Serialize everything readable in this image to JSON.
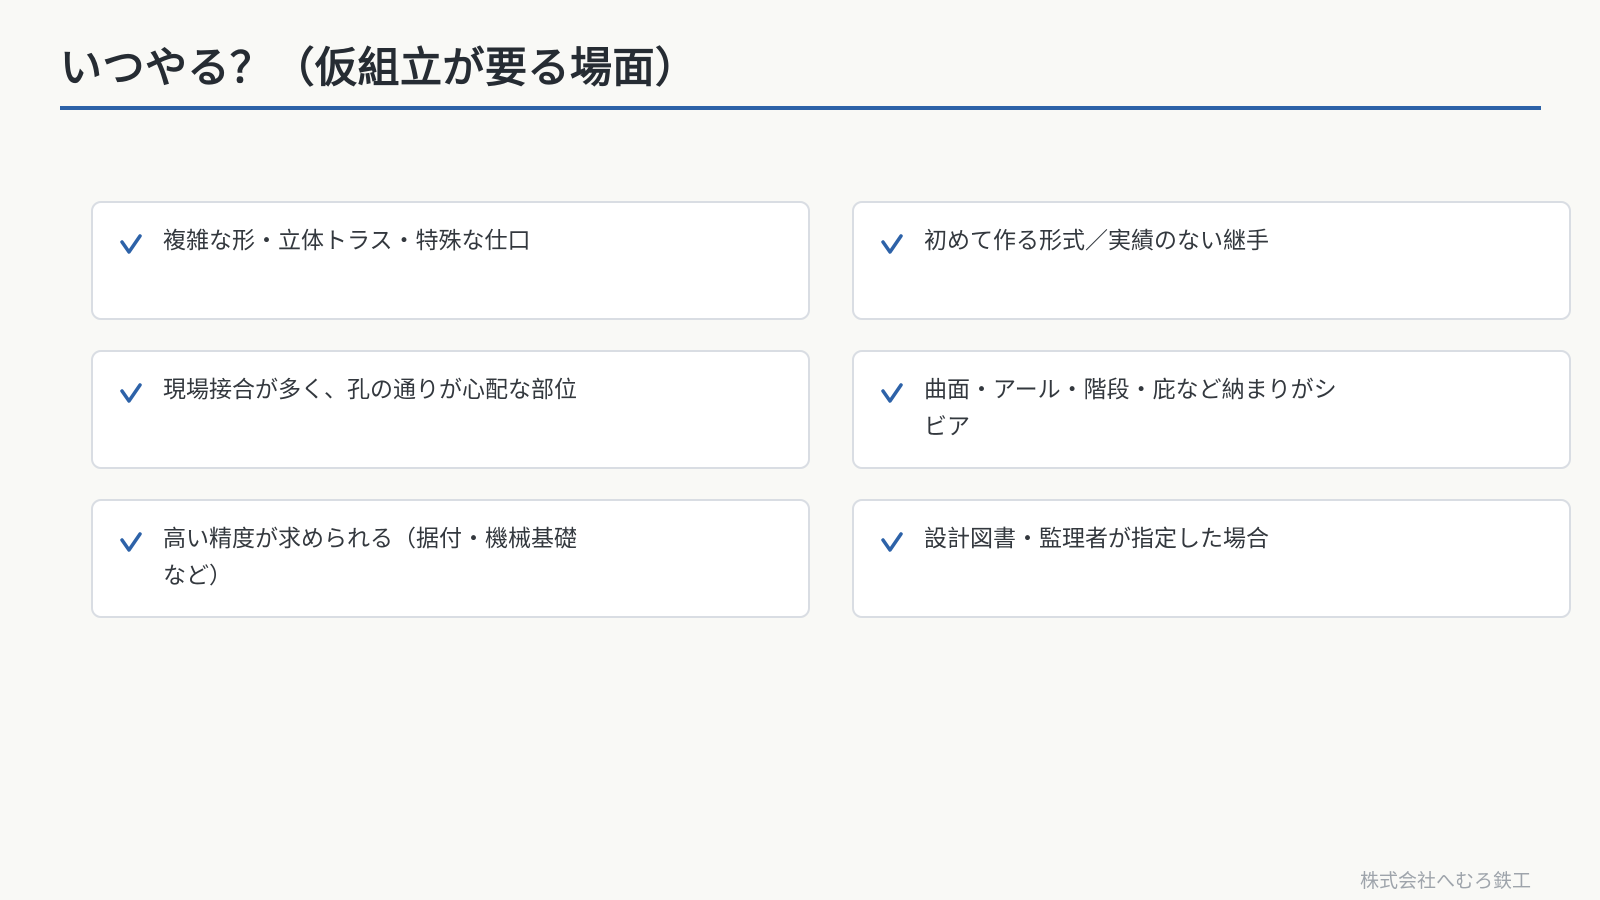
{
  "slide": {
    "title": "いつやる？（仮組立が要る場面）",
    "accent_color": "#2d62a8",
    "check_icon": "check-icon",
    "items": [
      {
        "text": "複雑な形・立体トラス・特殊な仕口"
      },
      {
        "text": "初めて作る形式／実績のない継手"
      },
      {
        "text": "現場接合が多く、孔の通りが心配な部位"
      },
      {
        "text": "曲面・アール・階段・庇など納まりがシビア"
      },
      {
        "text": "高い精度が求められる（据付・機械基礎など）"
      },
      {
        "text": "設計図書・監理者が指定した場合"
      }
    ],
    "footer": "株式会社へむろ鉄工"
  }
}
